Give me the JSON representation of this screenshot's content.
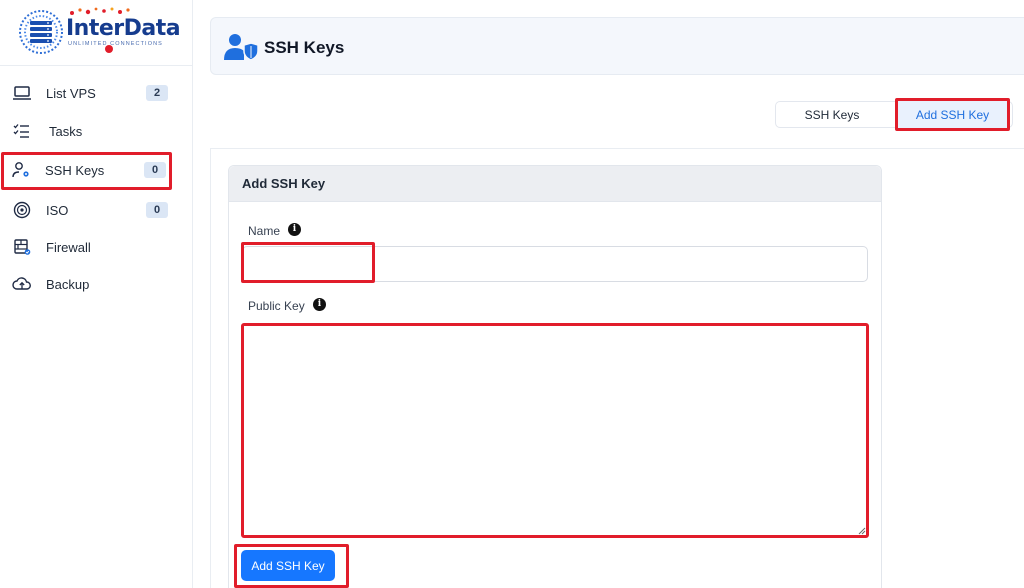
{
  "brand": {
    "name": "InterData",
    "tagline": "UNLIMITED CONNECTIONS"
  },
  "sidebar": {
    "items": [
      {
        "label": "List VPS",
        "badge": "2",
        "icon": "laptop-icon"
      },
      {
        "label": "Tasks",
        "badge": "",
        "icon": "task-list-icon"
      },
      {
        "label": "SSH Keys",
        "badge": "0",
        "icon": "user-key-icon"
      },
      {
        "label": "ISO",
        "badge": "0",
        "icon": "disc-icon"
      },
      {
        "label": "Firewall",
        "badge": "",
        "icon": "firewall-icon"
      },
      {
        "label": "Backup",
        "badge": "",
        "icon": "cloud-upload-icon"
      }
    ],
    "active_item": "SSH Keys"
  },
  "header": {
    "title": "SSH Keys",
    "icon": "user-shield-icon"
  },
  "tabs": [
    {
      "label": "SSH Keys",
      "active": false
    },
    {
      "label": "Add SSH Key",
      "active": true
    }
  ],
  "form": {
    "card_title": "Add SSH Key",
    "name_label": "Name",
    "name_value": "",
    "public_key_label": "Public Key",
    "public_key_value": "",
    "submit_label": "Add SSH Key",
    "info_icon": "info-icon"
  },
  "colors": {
    "accent": "#1677ff",
    "highlight": "#e11d2a",
    "brand_blue": "#163c8e",
    "badge_bg": "#dbe6f5",
    "header_bg": "#f4f7fc"
  }
}
